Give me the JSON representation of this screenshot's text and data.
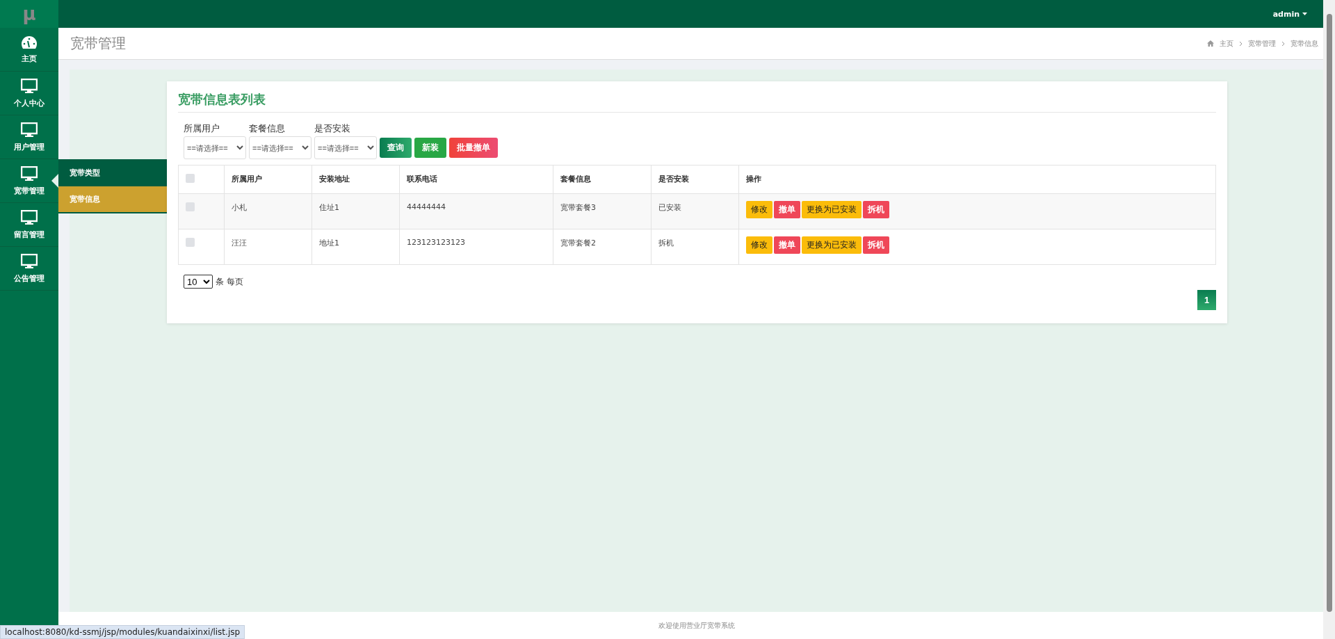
{
  "logo": "μ",
  "user_menu": {
    "label": "admin"
  },
  "sidebar": {
    "items": [
      {
        "label": "主页",
        "kind": "gauge",
        "selected": false
      },
      {
        "label": "个人中心",
        "kind": "monitor",
        "selected": false
      },
      {
        "label": "用户管理",
        "kind": "monitor",
        "selected": false
      },
      {
        "label": "宽带管理",
        "kind": "monitor",
        "selected": true,
        "children": [
          {
            "label": "宽带类型",
            "selected": false
          },
          {
            "label": "宽带信息",
            "selected": true
          }
        ]
      },
      {
        "label": "留言管理",
        "kind": "monitor",
        "selected": false
      },
      {
        "label": "公告管理",
        "kind": "monitor",
        "selected": false
      }
    ]
  },
  "page_title": "宽带管理",
  "breadcrumb": [
    "主页",
    "宽带管理",
    "宽带信息"
  ],
  "card_title": "宽带信息表列表",
  "filters": [
    {
      "label": "所属用户",
      "value": "==请选择=="
    },
    {
      "label": "套餐信息",
      "value": "==请选择=="
    },
    {
      "label": "是否安装",
      "value": "==请选择=="
    }
  ],
  "toolbar_buttons": [
    {
      "label": "查询",
      "kind": "search"
    },
    {
      "label": "新装",
      "kind": "add"
    },
    {
      "label": "批量撤单",
      "kind": "danger"
    }
  ],
  "table": {
    "select_all": {
      "checked": false
    },
    "columns": [
      "所属用户",
      "安装地址",
      "联系电话",
      "套餐信息",
      "是否安装",
      "操作"
    ],
    "rows": [
      {
        "checked": false,
        "cells": [
          "小札",
          "住址1",
          "44444444",
          "宽带套餐3",
          "已安装"
        ],
        "actions": [
          {
            "label": "修改",
            "kind": "warn"
          },
          {
            "label": "撤单",
            "kind": "danger"
          },
          {
            "label": "更换为已安装",
            "kind": "warn"
          },
          {
            "label": "拆机",
            "kind": "danger"
          }
        ]
      },
      {
        "checked": false,
        "cells": [
          "汪汪",
          "地址1",
          "123123123123",
          "宽带套餐2",
          "拆机"
        ],
        "actions": [
          {
            "label": "修改",
            "kind": "warn"
          },
          {
            "label": "撤单",
            "kind": "danger"
          },
          {
            "label": "更换为已安装",
            "kind": "warn"
          },
          {
            "label": "拆机",
            "kind": "danger"
          }
        ]
      }
    ]
  },
  "page_size": {
    "value": "10",
    "label": "条 每页"
  },
  "pagination": [
    {
      "label": "1",
      "selected": true
    }
  ],
  "footer": "欢迎使用营业厅宽带系统",
  "status_url": "localhost:8080/kd-ssmj/jsp/modules/kuandaixinxi/list.jsp"
}
